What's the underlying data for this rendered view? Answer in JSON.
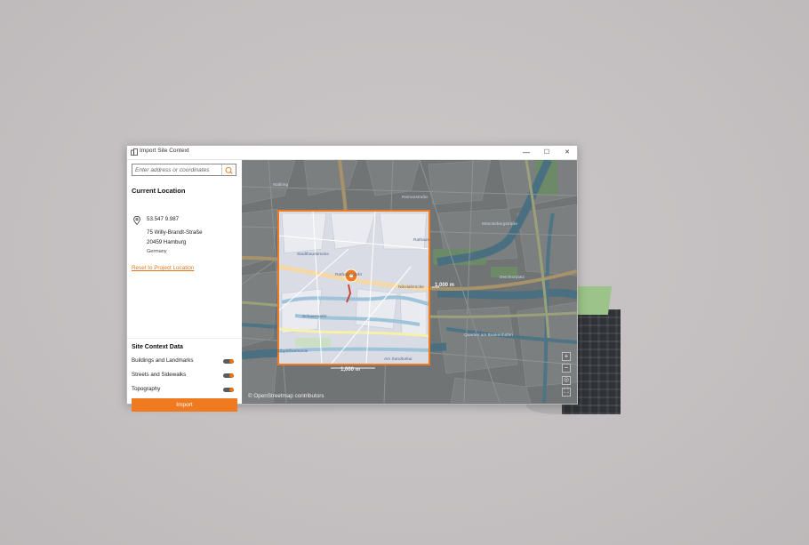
{
  "window": {
    "title": "Import Site Context",
    "controls": {
      "minimize": "—",
      "maximize": "☐",
      "close": "✕"
    }
  },
  "search": {
    "placeholder": "Enter address or coordinates"
  },
  "location": {
    "heading": "Current Location",
    "coordinates": "53.547 9.987",
    "street": "75 Willy-Brandt-Straße",
    "city": "20459 Hamburg",
    "country": "Germany",
    "reset_label": "Reset to Project Location"
  },
  "site_context": {
    "heading": "Site Context Data",
    "options": [
      {
        "label": "Buildings and Landmarks",
        "enabled": true
      },
      {
        "label": "Streets and Sidewalks",
        "enabled": true
      },
      {
        "label": "Topography",
        "enabled": true
      }
    ],
    "import_label": "Import"
  },
  "map": {
    "attribution": "© OpenStreetmap contributors",
    "scale_horizontal": "1,000 m",
    "scale_vertical": "1,000 m",
    "street_labels": [
      "Stadthausbrücke",
      "Nikolaibrücke",
      "Rathausmarkt",
      "Schaarmarkt",
      "Elbphilharmonie",
      "Am Sandtorkai",
      "Wallring",
      "Mönckebergstraße",
      "Deichtorplatz",
      "Rathaus",
      "Reimarstraße",
      "Quartier am Baakenhafen"
    ],
    "controls": {
      "zoom_in": "+",
      "zoom_out": "−",
      "locate": "◎",
      "fullscreen": "⛶"
    },
    "accent_color": "#ef7a1f"
  }
}
